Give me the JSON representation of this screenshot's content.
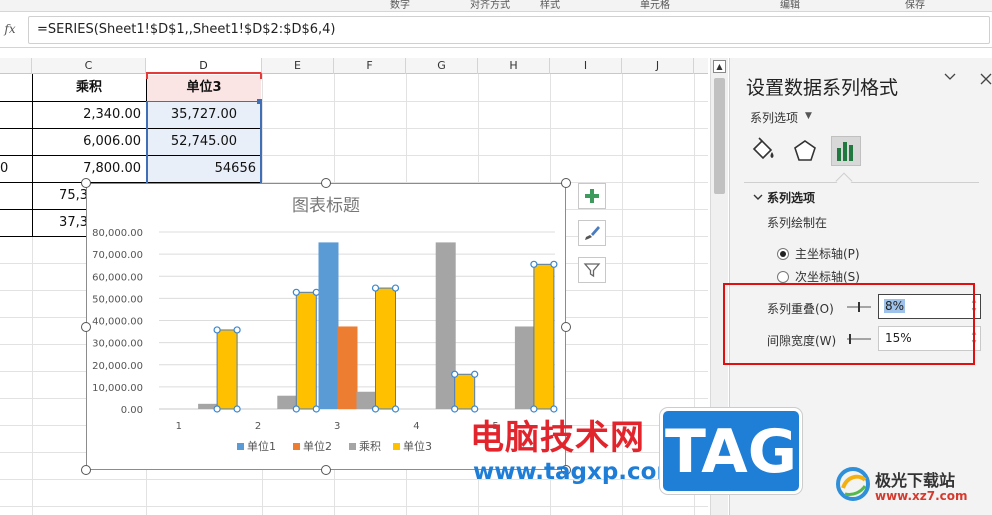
{
  "ribbon": {
    "tabs": [
      "数字",
      "对齐方式",
      "样式",
      "单元格",
      "编辑",
      "保存"
    ]
  },
  "formula_bar": {
    "fx": "fx",
    "formula": "=SERIES(Sheet1!$D$1,,Sheet1!$D$2:$D$6,4)"
  },
  "grid": {
    "columns": [
      "C",
      "D",
      "E",
      "F",
      "G",
      "H",
      "I",
      "J"
    ],
    "selected_column": "D",
    "rows": [
      {
        "b": "",
        "c": "乘积",
        "d": "单位3"
      },
      {
        "b": "",
        "c": "2,340.00",
        "d": "35,727.00"
      },
      {
        "b": "",
        "c": "6,006.00",
        "d": "52,745.00"
      },
      {
        "b": "0",
        "c": "7,800.00",
        "d": "54656"
      },
      {
        "b": "",
        "c": "75,3",
        "d": ""
      },
      {
        "b": "",
        "c": "37,3",
        "d": ""
      }
    ]
  },
  "chart_tools": {
    "add_elements": "+",
    "styles": "brush",
    "filter": "filter"
  },
  "chart_data": {
    "type": "bar",
    "title": "图表标题",
    "categories": [
      "1",
      "2",
      "3",
      "4",
      "5"
    ],
    "ylim": [
      0,
      80000
    ],
    "yticks": [
      "0.00",
      "10,000.00",
      "20,000.00",
      "30,000.00",
      "40,000.00",
      "50,000.00",
      "60,000.00",
      "70,000.00",
      "80,000.00"
    ],
    "grid": true,
    "legend_position": "bottom",
    "series": [
      {
        "name": "单位1",
        "color": "#5b9bd5",
        "values": [
          0,
          0,
          75300,
          0,
          0
        ]
      },
      {
        "name": "单位2",
        "color": "#ed7d31",
        "values": [
          0,
          0,
          37300,
          0,
          0
        ]
      },
      {
        "name": "乘积",
        "color": "#a5a5a5",
        "values": [
          2340,
          6006,
          7800,
          75300,
          37300
        ]
      },
      {
        "name": "单位3",
        "color": "#ffc000",
        "values": [
          35727,
          52745,
          54656,
          15700,
          65400
        ],
        "selected": true
      }
    ]
  },
  "pane": {
    "title": "设置数据系列格式",
    "dropdown": "系列选项",
    "section_title": "系列选项",
    "plot_on_label": "系列绘制在",
    "primary_axis": "主坐标轴(P)",
    "secondary_axis": "次坐标轴(S)",
    "overlap_label": "系列重叠(O)",
    "overlap_value": "8%",
    "gap_label": "间隙宽度(W)",
    "gap_value": "15%"
  },
  "watermark": {
    "site_name": "电脑技术网",
    "site_url": "www.tagxp.com",
    "tag": "TAG",
    "logo_name": "极光下载站",
    "logo_url": "www.xz7.com"
  }
}
